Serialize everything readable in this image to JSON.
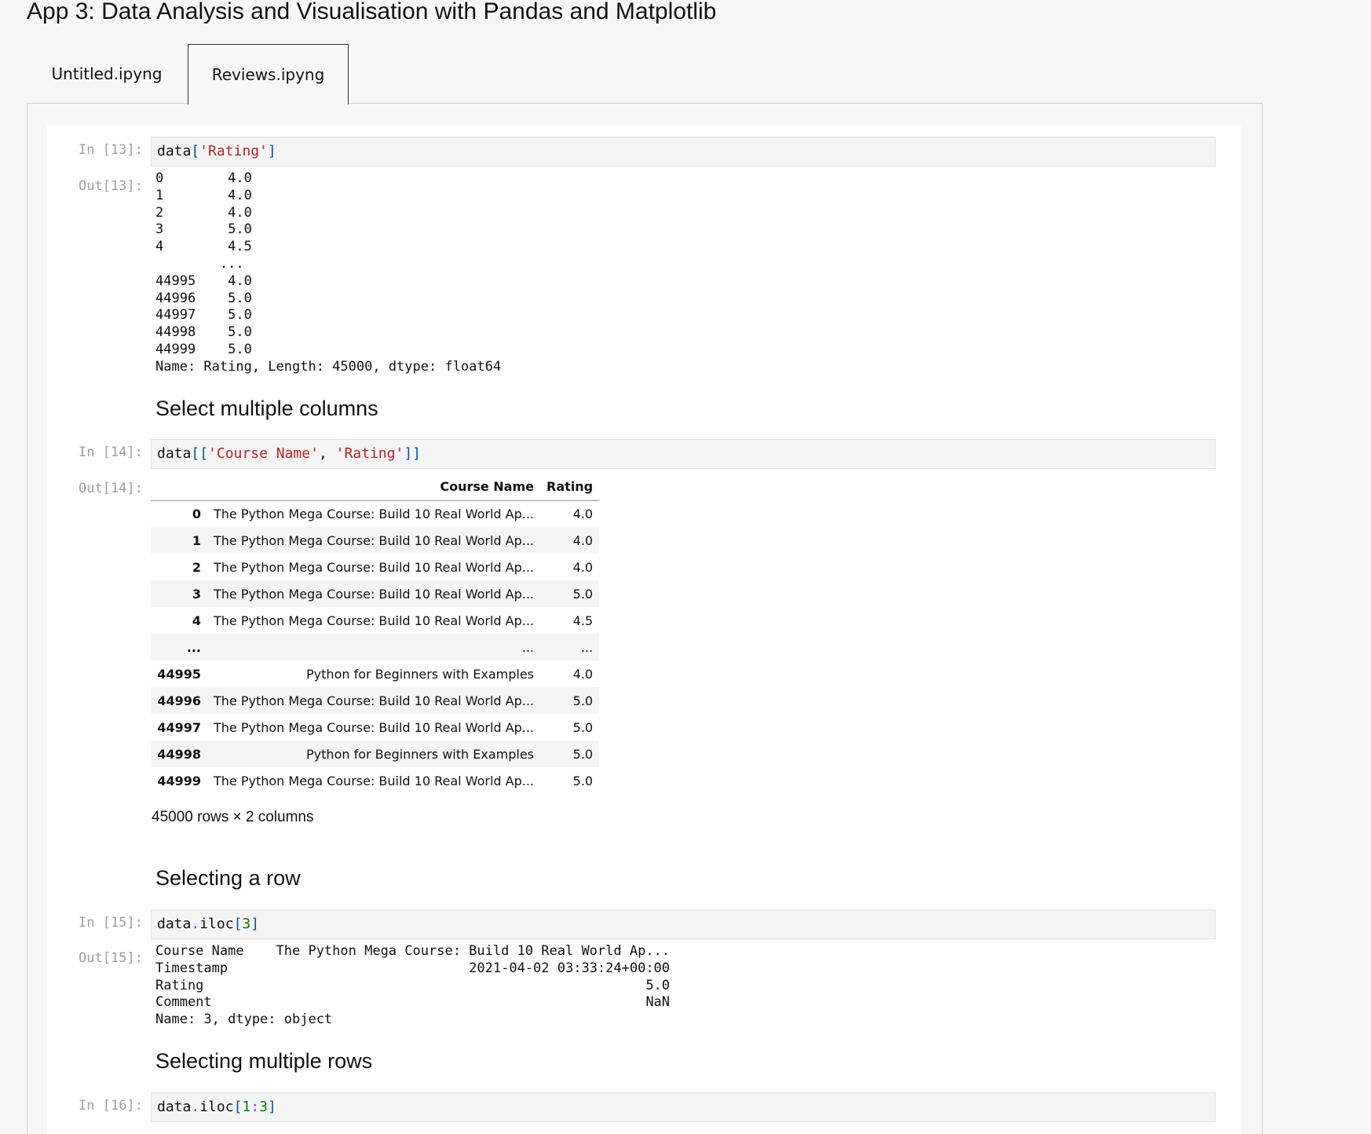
{
  "page_title": "App 3: Data Analysis and Visualisation with Pandas and Matplotlib",
  "tabs": [
    {
      "label": "Untitled.ipyng",
      "active": false
    },
    {
      "label": "Reviews.ipyng",
      "active": true
    }
  ],
  "cells": {
    "c13": {
      "in_prompt": "In [13]:",
      "out_prompt": "Out[13]:",
      "code": {
        "var": "data",
        "open": "[",
        "str": "'Rating'",
        "close": "]"
      },
      "output": "0        4.0\n1        4.0\n2        4.0\n3        5.0\n4        4.5\n        ... \n44995    4.0\n44996    5.0\n44997    5.0\n44998    5.0\n44999    5.0\nName: Rating, Length: 45000, dtype: float64"
    },
    "h_multi_cols": "Select multiple columns",
    "c14": {
      "in_prompt": "In [14]:",
      "out_prompt": "Out[14]:",
      "code": {
        "var": "data",
        "open": "[[",
        "str1": "'Course Name'",
        "sep": ", ",
        "str2": "'Rating'",
        "close": "]]"
      },
      "table": {
        "columns": [
          "",
          "Course Name",
          "Rating"
        ],
        "rows": [
          {
            "idx": "0",
            "name": "The Python Mega Course: Build 10 Real World Ap...",
            "rating": "4.0"
          },
          {
            "idx": "1",
            "name": "The Python Mega Course: Build 10 Real World Ap...",
            "rating": "4.0"
          },
          {
            "idx": "2",
            "name": "The Python Mega Course: Build 10 Real World Ap...",
            "rating": "4.0"
          },
          {
            "idx": "3",
            "name": "The Python Mega Course: Build 10 Real World Ap...",
            "rating": "5.0"
          },
          {
            "idx": "4",
            "name": "The Python Mega Course: Build 10 Real World Ap...",
            "rating": "4.5"
          },
          {
            "idx": "...",
            "name": "...",
            "rating": "..."
          },
          {
            "idx": "44995",
            "name": "Python for Beginners with Examples",
            "rating": "4.0"
          },
          {
            "idx": "44996",
            "name": "The Python Mega Course: Build 10 Real World Ap...",
            "rating": "5.0"
          },
          {
            "idx": "44997",
            "name": "The Python Mega Course: Build 10 Real World Ap...",
            "rating": "5.0"
          },
          {
            "idx": "44998",
            "name": "Python for Beginners with Examples",
            "rating": "5.0"
          },
          {
            "idx": "44999",
            "name": "The Python Mega Course: Build 10 Real World Ap...",
            "rating": "5.0"
          }
        ],
        "shape": "45000 rows × 2 columns"
      }
    },
    "h_row": "Selecting a row",
    "c15": {
      "in_prompt": "In [15]:",
      "out_prompt": "Out[15]:",
      "code": {
        "var": "data",
        "dot": ".",
        "attr": "iloc",
        "open": "[",
        "num": "3",
        "close": "]"
      },
      "output": "Course Name    The Python Mega Course: Build 10 Real World Ap...\nTimestamp                              2021-04-02 03:33:24+00:00\nRating                                                       5.0\nComment                                                      NaN\nName: 3, dtype: object"
    },
    "h_multi_rows": "Selecting multiple rows",
    "c16": {
      "in_prompt": "In [16]:",
      "code": {
        "var": "data",
        "dot": ".",
        "attr": "iloc",
        "open": "[",
        "num1": "1",
        "colon": ":",
        "num2": "3",
        "close": "]"
      }
    }
  }
}
